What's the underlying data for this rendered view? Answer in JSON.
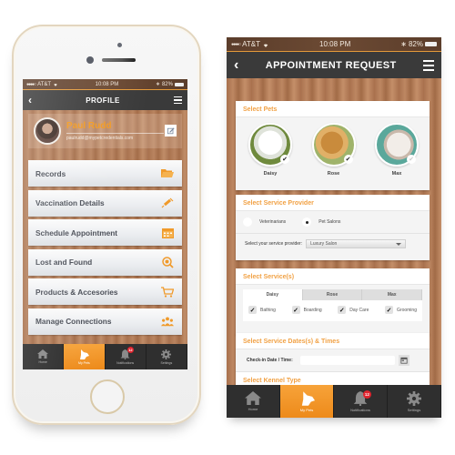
{
  "status_bar": {
    "signal_dots": "●●●●○",
    "carrier": "AT&T",
    "time": "10:08 PM",
    "bluetooth_icon": "bluetooth-icon",
    "battery": "82%"
  },
  "profile_screen": {
    "title": "PROFILE",
    "user": {
      "name": "Paul Rudd",
      "email": "paulrudd@mypetcredentials.com"
    },
    "menu": [
      {
        "label": "Records",
        "icon": "folder-icon"
      },
      {
        "label": "Vaccination Details",
        "icon": "syringe-icon"
      },
      {
        "label": "Schedule Appointment",
        "icon": "calendar-icon"
      },
      {
        "label": "Lost and Found",
        "icon": "search-pet-icon"
      },
      {
        "label": "Products & Accesories",
        "icon": "cart-icon"
      },
      {
        "label": "Manage Connections",
        "icon": "people-icon"
      }
    ]
  },
  "appointment_screen": {
    "title": "APPOINTMENT REQUEST",
    "select_pets": {
      "heading": "Select Pets",
      "pets": [
        {
          "name": "Daisy",
          "selected": true
        },
        {
          "name": "Rose",
          "selected": true
        },
        {
          "name": "Max",
          "selected": false
        }
      ]
    },
    "service_provider": {
      "heading": "Select Service Provider",
      "options": [
        {
          "label": "Veterinarians",
          "selected": false
        },
        {
          "label": "Pet Salons",
          "selected": true
        }
      ],
      "provider_label": "Select your service provider:",
      "provider_value": "Luxury Salon"
    },
    "services": {
      "heading": "Select Service(s)",
      "tabs": [
        {
          "label": "Daisy",
          "active": true
        },
        {
          "label": "Rose",
          "active": false
        },
        {
          "label": "Max",
          "active": false
        }
      ],
      "options": [
        {
          "label": "Bathing",
          "checked": true
        },
        {
          "label": "Boarding",
          "checked": true
        },
        {
          "label": "Day Care",
          "checked": true
        },
        {
          "label": "Grooming",
          "checked": true
        }
      ]
    },
    "dates": {
      "heading": "Select Service Dates(s) & Times",
      "checkin_label": "Check-in Date / Time:",
      "checkin_value": ""
    },
    "kennel": {
      "heading": "Select Kennel Type"
    }
  },
  "tabbar": {
    "tabs": [
      {
        "label": "Home",
        "icon": "home-icon",
        "active": false
      },
      {
        "label": "My Pets",
        "icon": "dog-icon",
        "active": true
      },
      {
        "label": "Notifications",
        "icon": "bell-icon",
        "active": false,
        "badge": "12"
      },
      {
        "label": "Settings",
        "icon": "gear-icon",
        "active": false
      }
    ]
  },
  "colors": {
    "accent": "#F39A1F",
    "nav_bg": "#3A3A3A",
    "badge": "#E0242E",
    "card_heading": "#F1A144"
  }
}
